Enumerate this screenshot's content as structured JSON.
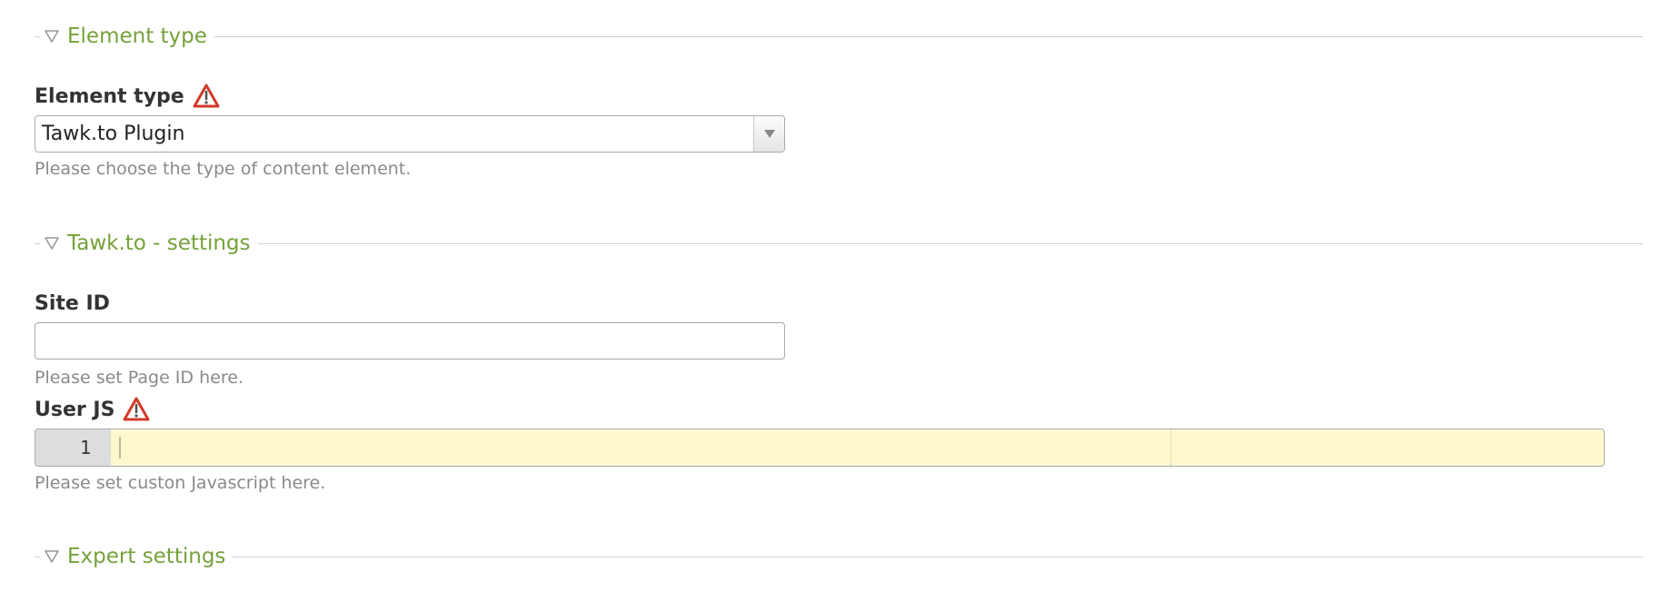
{
  "sections": {
    "element_type": {
      "legend": "Element type"
    },
    "tawkto_settings": {
      "legend": "Tawk.to - settings"
    },
    "expert_settings": {
      "legend": "Expert settings"
    }
  },
  "fields": {
    "element_type": {
      "label": "Element type",
      "selected_value": "Tawk.to Plugin",
      "help": "Please choose the type of content element."
    },
    "site_id": {
      "label": "Site ID",
      "value": "",
      "placeholder": "",
      "help": "Please set Page ID here."
    },
    "user_js": {
      "label": "User JS",
      "line_number": "1",
      "value": "",
      "help": "Please set custon Javascript here."
    }
  },
  "icons": {
    "toggle": "triangle-down-icon",
    "warning": "warning-triangle-icon",
    "select_arrow": "chevron-down-icon"
  },
  "colors": {
    "legend_text": "#75a23a",
    "warning_red": "#d23a2a",
    "editor_background": "#fffad4",
    "help_text": "#8a8a8a"
  }
}
